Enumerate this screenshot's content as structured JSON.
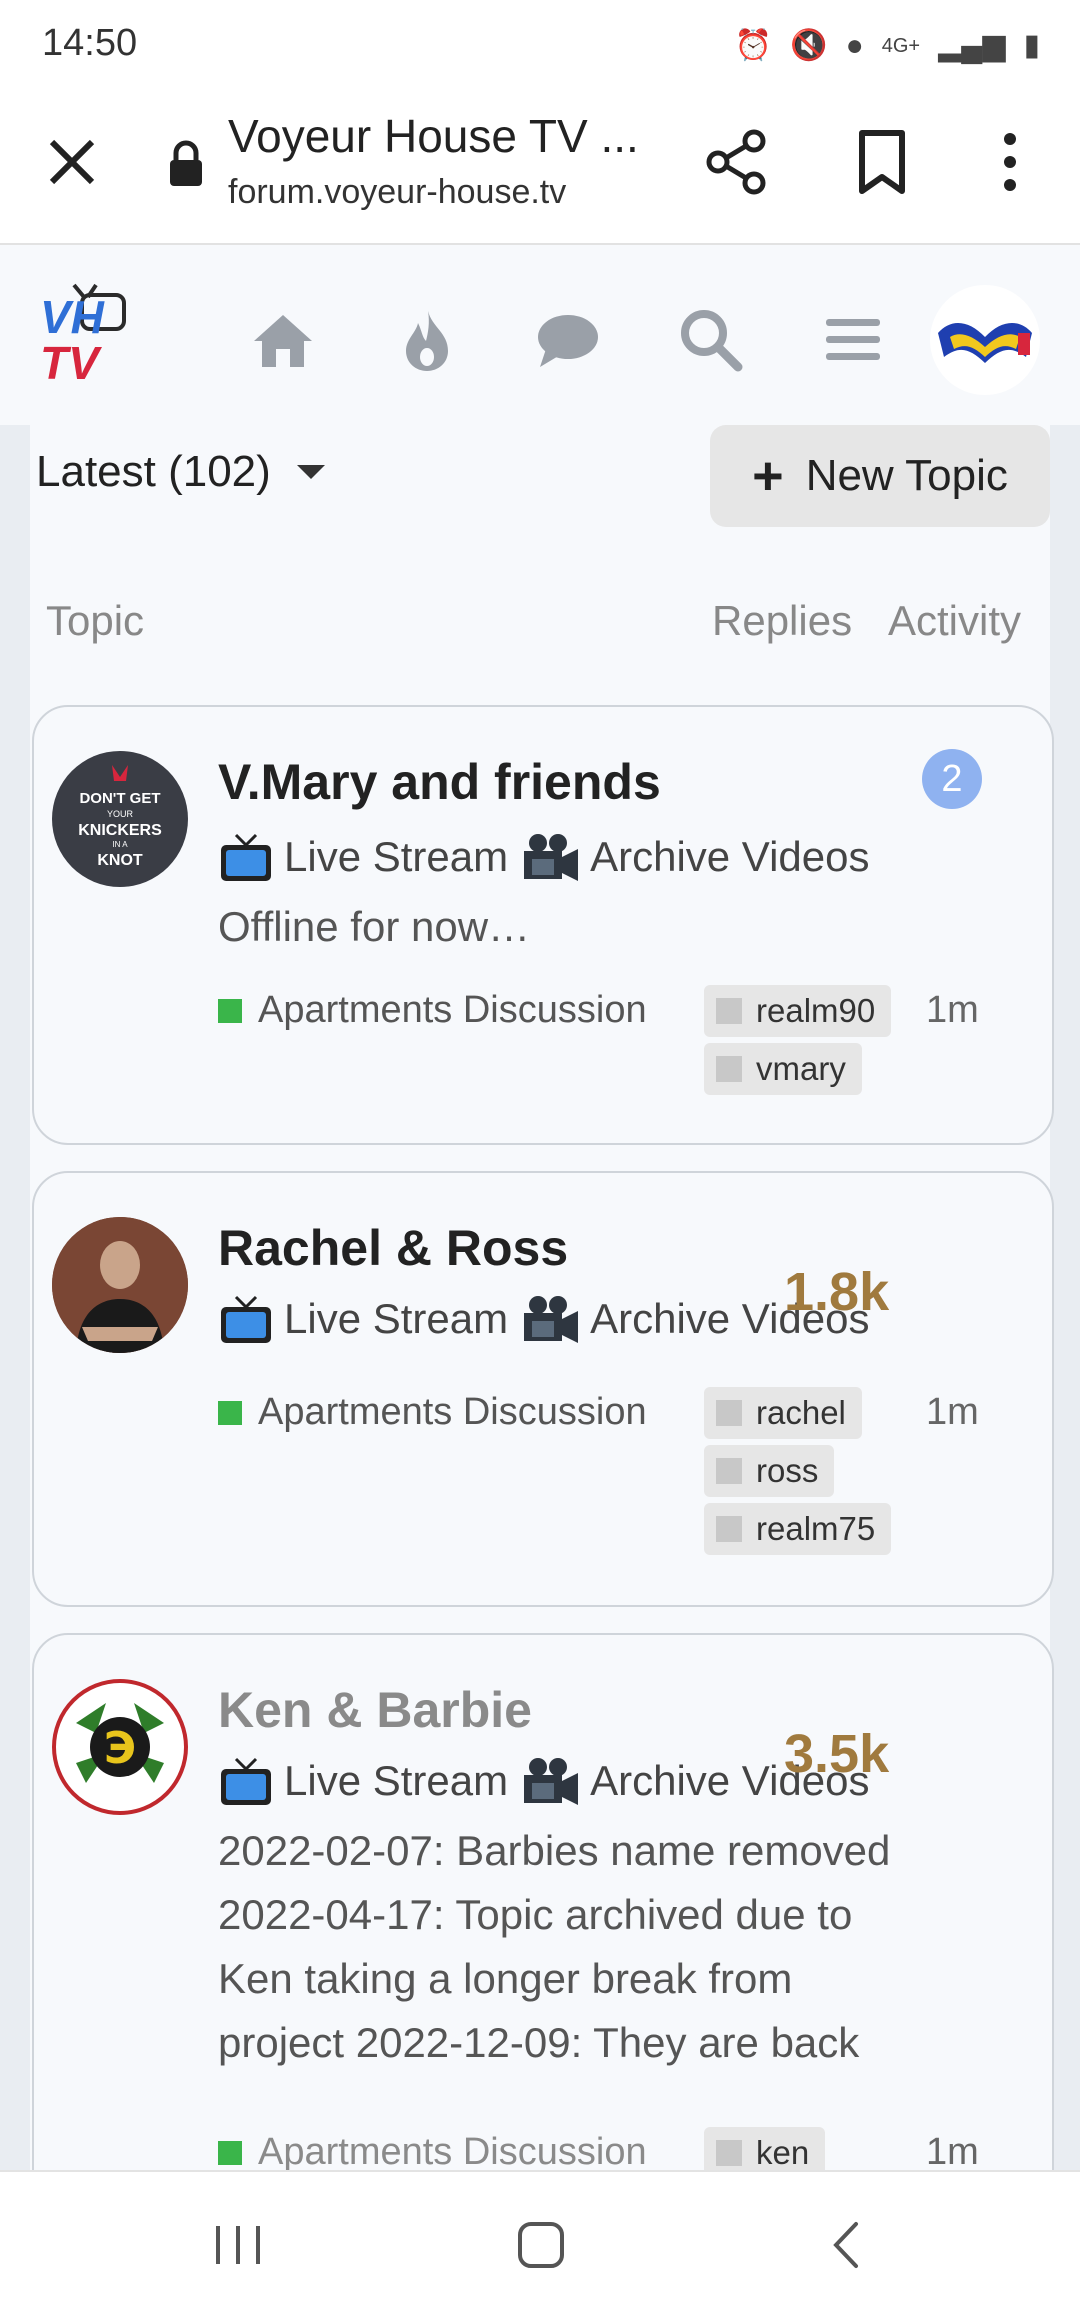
{
  "status": {
    "time": "14:50",
    "network": "4G+"
  },
  "browser": {
    "title": "Voyeur House TV ...",
    "url": "forum.voyeur-house.tv"
  },
  "site": {
    "logo_top": "VH",
    "logo_bottom": "TV"
  },
  "list": {
    "filter_label": "Latest (102)",
    "new_topic_label": "New Topic",
    "col_topic": "Topic",
    "col_replies": "Replies",
    "col_activity": "Activity"
  },
  "topics": [
    {
      "title": "V.Mary and friends",
      "live": "Live Stream",
      "archive": "Archive Videos",
      "excerpt": "Offline for now…",
      "category": "Apartments Discussion",
      "tags": [
        "realm90",
        "vmary"
      ],
      "activity": "1m",
      "unread": "2",
      "avatar_text": [
        "DON'T GET",
        "YOUR",
        "KNICKERS",
        "IN A",
        "KNOT"
      ]
    },
    {
      "title": "Rachel & Ross",
      "live": "Live Stream",
      "archive": "Archive Videos",
      "replies": "1.8k",
      "category": "Apartments Discussion",
      "tags": [
        "rachel",
        "ross",
        "realm75"
      ],
      "activity": "1m"
    },
    {
      "title": "Ken & Barbie",
      "live": "Live Stream",
      "archive": "Archive Videos",
      "replies": "3.5k",
      "excerpt_lines": [
        "2022-02-07: Barbies name removed",
        "2022-04-17: Topic archived due to",
        "Ken taking a longer break from",
        "project 2022-12-09: They are back"
      ],
      "category": "Apartments Discussion",
      "tags": [
        "ken"
      ],
      "activity": "1m"
    }
  ],
  "colors": {
    "category": "#3ab54a",
    "replies": "#a07a3e",
    "badge": "#8fb2f0",
    "tv_blue": "#3d8fe6"
  },
  "icons": [
    "close-icon",
    "lock-icon",
    "share-icon",
    "bookmark-icon",
    "more-icon",
    "home-icon",
    "fire-icon",
    "chat-icon",
    "search-icon",
    "hamburger-icon",
    "tv-icon",
    "camera-icon"
  ]
}
